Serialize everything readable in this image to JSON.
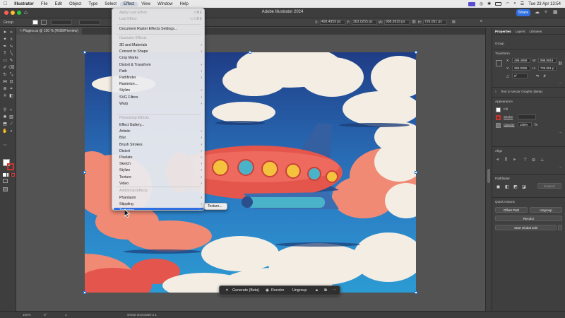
{
  "menubar": {
    "app_name": "Illustrator",
    "items": [
      "File",
      "Edit",
      "Object",
      "Type",
      "Select",
      "Effect",
      "View",
      "Window",
      "Help"
    ],
    "active_item": "Effect",
    "clock": "Tue 23 Apr  13:54"
  },
  "window": {
    "title": "Adobe Illustrator 2024",
    "share_label": "Share"
  },
  "controlbar": {
    "selection_label": "Group",
    "x": "499.4959 px",
    "y": "363.0255 px",
    "w": "998.9918 px",
    "h": "726.051 px"
  },
  "document_tab": {
    "label": "Plugins.ai @ 100 % (RGB/Preview)"
  },
  "effect_menu": {
    "top_items": [
      {
        "label": "Apply Last Effect",
        "shortcut": "⇧⌘E",
        "disabled": true
      },
      {
        "label": "Last Effect",
        "shortcut": "⌥⇧⌘E",
        "disabled": true
      }
    ],
    "raster_settings": "Document Raster Effects Settings...",
    "illustrator_header": "Illustrator Effects",
    "illustrator_items": [
      {
        "label": "3D and Materials",
        "submenu": true
      },
      {
        "label": "Convert to Shape",
        "submenu": true
      },
      {
        "label": "Crop Marks",
        "submenu": false
      },
      {
        "label": "Distort & Transform",
        "submenu": true
      },
      {
        "label": "Path",
        "submenu": true
      },
      {
        "label": "Pathfinder",
        "submenu": true
      },
      {
        "label": "Rasterize...",
        "submenu": false
      },
      {
        "label": "Stylize",
        "submenu": true
      },
      {
        "label": "SVG Filters",
        "submenu": true
      },
      {
        "label": "Warp",
        "submenu": true
      }
    ],
    "photoshop_header": "Photoshop Effects",
    "photoshop_items": [
      {
        "label": "Effect Gallery...",
        "submenu": false
      },
      {
        "label": "Artistic",
        "submenu": true
      },
      {
        "label": "Blur",
        "submenu": true
      },
      {
        "label": "Brush Strokes",
        "submenu": true
      },
      {
        "label": "Distort",
        "submenu": true
      },
      {
        "label": "Pixelate",
        "submenu": true
      },
      {
        "label": "Sketch",
        "submenu": true
      },
      {
        "label": "Stylize",
        "submenu": true
      },
      {
        "label": "Texture",
        "submenu": true
      },
      {
        "label": "Video",
        "submenu": true
      }
    ],
    "additional_header": "Additional Effects",
    "additional_items": [
      {
        "label": "Phantasm",
        "submenu": true
      },
      {
        "label": "Stippling",
        "submenu": true
      },
      {
        "label": "Texturino",
        "submenu": true,
        "highlighted": true
      }
    ],
    "submenu_item": "Texture..."
  },
  "context_bar": {
    "generate": "Generate (Beta)",
    "recolor": "Recolor",
    "ungroup": "Ungroup"
  },
  "panel": {
    "tabs": [
      "Properties",
      "Layers",
      "Libraries"
    ],
    "active_tab": "Properties",
    "selection_type": "Group",
    "transform_title": "Transform",
    "x_label": "X:",
    "x_value": "499.4959",
    "y_label": "Y:",
    "y_value": "363.0255",
    "w_label": "W:",
    "w_value": "998.9918",
    "h_label": "H:",
    "h_value": "726.051 p",
    "angle_value": "0°",
    "text_to_vector": "Text to Vector Graphic (Beta)",
    "appearance_title": "Appearance",
    "fill_label": "Fill",
    "stroke_label": "Stroke",
    "opacity_label": "Opacity",
    "opacity_value": "100%",
    "align_title": "Align",
    "pathfinder_title": "Pathfinder",
    "expand_label": "Expand",
    "quick_actions_title": "Quick Actions",
    "offset_path": "Offset Path",
    "ungroup": "Ungroup",
    "recolor": "Recolor",
    "start_global_edit": "Start Global Edit"
  },
  "statusbar": {
    "zoom": "100%",
    "angle": "0°",
    "page": "1",
    "info": "sRGB IEC61966-2.1"
  },
  "colors": {
    "menu_highlight": "#2f6fdf",
    "sky_top": "#1f3d86",
    "sky_bottom": "#2c9bd3",
    "plane_body": "#e4564c",
    "plane_tail": "#345fa0"
  }
}
